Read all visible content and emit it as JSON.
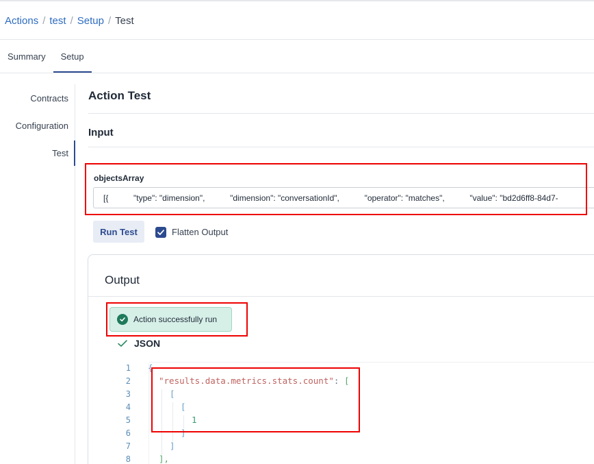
{
  "breadcrumb": {
    "items": [
      "Actions",
      "test",
      "Setup"
    ],
    "separator": "/",
    "current": "Test"
  },
  "tabs": [
    "Summary",
    "Setup"
  ],
  "active_tab": "Setup",
  "sidenav": {
    "items": [
      "Contracts",
      "Configuration",
      "Test"
    ],
    "active": "Test"
  },
  "main": {
    "title": "Action Test",
    "input_section": "Input",
    "field_label": "objectsArray",
    "field_value": "[{           \"type\": \"dimension\",           \"dimension\": \"conversationId\",           \"operator\": \"matches\",           \"value\": \"bd2d6ff8-84d7-",
    "run_button": "Run Test",
    "flatten_label": "Flatten Output",
    "flatten_checked": true
  },
  "output": {
    "title": "Output",
    "status_text": "Action successfully run",
    "json_tab": "JSON",
    "line_numbers": [
      "1",
      "2",
      "3",
      "4",
      "5",
      "6",
      "7",
      "8"
    ],
    "code": {
      "line1": "{",
      "line2_key": "\"results.data.metrics.stats.count\"",
      "line2_colon": ": ",
      "line2_bracket": "[",
      "line3": "[",
      "line4": "[",
      "line5": "1",
      "line6": "]",
      "line7": "]",
      "line8": "],"
    }
  },
  "colors": {
    "accent": "#2c4a8f",
    "link": "#2d6cc0",
    "success_bg": "#d6f0e8",
    "success_icon": "#1f7a5c",
    "annotation": "#ee0000"
  },
  "icons": [
    "check-circle-icon",
    "check-icon",
    "checkbox-checked-icon"
  ]
}
